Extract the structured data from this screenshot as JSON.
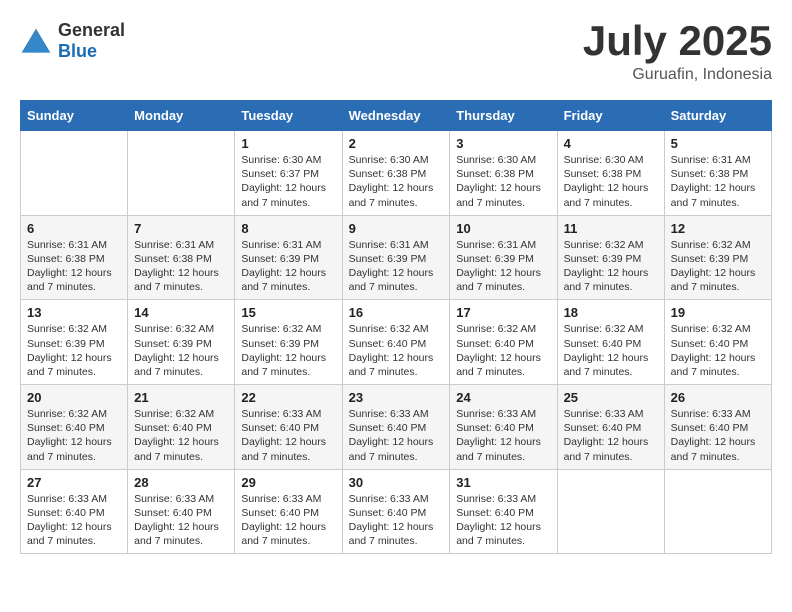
{
  "header": {
    "logo_general": "General",
    "logo_blue": "Blue",
    "month": "July 2025",
    "location": "Guruafin, Indonesia"
  },
  "days_of_week": [
    "Sunday",
    "Monday",
    "Tuesday",
    "Wednesday",
    "Thursday",
    "Friday",
    "Saturday"
  ],
  "weeks": [
    [
      {
        "day": "",
        "info": ""
      },
      {
        "day": "",
        "info": ""
      },
      {
        "day": "1",
        "info": "Sunrise: 6:30 AM\nSunset: 6:37 PM\nDaylight: 12 hours\nand 7 minutes."
      },
      {
        "day": "2",
        "info": "Sunrise: 6:30 AM\nSunset: 6:38 PM\nDaylight: 12 hours\nand 7 minutes."
      },
      {
        "day": "3",
        "info": "Sunrise: 6:30 AM\nSunset: 6:38 PM\nDaylight: 12 hours\nand 7 minutes."
      },
      {
        "day": "4",
        "info": "Sunrise: 6:30 AM\nSunset: 6:38 PM\nDaylight: 12 hours\nand 7 minutes."
      },
      {
        "day": "5",
        "info": "Sunrise: 6:31 AM\nSunset: 6:38 PM\nDaylight: 12 hours\nand 7 minutes."
      }
    ],
    [
      {
        "day": "6",
        "info": "Sunrise: 6:31 AM\nSunset: 6:38 PM\nDaylight: 12 hours\nand 7 minutes."
      },
      {
        "day": "7",
        "info": "Sunrise: 6:31 AM\nSunset: 6:38 PM\nDaylight: 12 hours\nand 7 minutes."
      },
      {
        "day": "8",
        "info": "Sunrise: 6:31 AM\nSunset: 6:39 PM\nDaylight: 12 hours\nand 7 minutes."
      },
      {
        "day": "9",
        "info": "Sunrise: 6:31 AM\nSunset: 6:39 PM\nDaylight: 12 hours\nand 7 minutes."
      },
      {
        "day": "10",
        "info": "Sunrise: 6:31 AM\nSunset: 6:39 PM\nDaylight: 12 hours\nand 7 minutes."
      },
      {
        "day": "11",
        "info": "Sunrise: 6:32 AM\nSunset: 6:39 PM\nDaylight: 12 hours\nand 7 minutes."
      },
      {
        "day": "12",
        "info": "Sunrise: 6:32 AM\nSunset: 6:39 PM\nDaylight: 12 hours\nand 7 minutes."
      }
    ],
    [
      {
        "day": "13",
        "info": "Sunrise: 6:32 AM\nSunset: 6:39 PM\nDaylight: 12 hours\nand 7 minutes."
      },
      {
        "day": "14",
        "info": "Sunrise: 6:32 AM\nSunset: 6:39 PM\nDaylight: 12 hours\nand 7 minutes."
      },
      {
        "day": "15",
        "info": "Sunrise: 6:32 AM\nSunset: 6:39 PM\nDaylight: 12 hours\nand 7 minutes."
      },
      {
        "day": "16",
        "info": "Sunrise: 6:32 AM\nSunset: 6:40 PM\nDaylight: 12 hours\nand 7 minutes."
      },
      {
        "day": "17",
        "info": "Sunrise: 6:32 AM\nSunset: 6:40 PM\nDaylight: 12 hours\nand 7 minutes."
      },
      {
        "day": "18",
        "info": "Sunrise: 6:32 AM\nSunset: 6:40 PM\nDaylight: 12 hours\nand 7 minutes."
      },
      {
        "day": "19",
        "info": "Sunrise: 6:32 AM\nSunset: 6:40 PM\nDaylight: 12 hours\nand 7 minutes."
      }
    ],
    [
      {
        "day": "20",
        "info": "Sunrise: 6:32 AM\nSunset: 6:40 PM\nDaylight: 12 hours\nand 7 minutes."
      },
      {
        "day": "21",
        "info": "Sunrise: 6:32 AM\nSunset: 6:40 PM\nDaylight: 12 hours\nand 7 minutes."
      },
      {
        "day": "22",
        "info": "Sunrise: 6:33 AM\nSunset: 6:40 PM\nDaylight: 12 hours\nand 7 minutes."
      },
      {
        "day": "23",
        "info": "Sunrise: 6:33 AM\nSunset: 6:40 PM\nDaylight: 12 hours\nand 7 minutes."
      },
      {
        "day": "24",
        "info": "Sunrise: 6:33 AM\nSunset: 6:40 PM\nDaylight: 12 hours\nand 7 minutes."
      },
      {
        "day": "25",
        "info": "Sunrise: 6:33 AM\nSunset: 6:40 PM\nDaylight: 12 hours\nand 7 minutes."
      },
      {
        "day": "26",
        "info": "Sunrise: 6:33 AM\nSunset: 6:40 PM\nDaylight: 12 hours\nand 7 minutes."
      }
    ],
    [
      {
        "day": "27",
        "info": "Sunrise: 6:33 AM\nSunset: 6:40 PM\nDaylight: 12 hours\nand 7 minutes."
      },
      {
        "day": "28",
        "info": "Sunrise: 6:33 AM\nSunset: 6:40 PM\nDaylight: 12 hours\nand 7 minutes."
      },
      {
        "day": "29",
        "info": "Sunrise: 6:33 AM\nSunset: 6:40 PM\nDaylight: 12 hours\nand 7 minutes."
      },
      {
        "day": "30",
        "info": "Sunrise: 6:33 AM\nSunset: 6:40 PM\nDaylight: 12 hours\nand 7 minutes."
      },
      {
        "day": "31",
        "info": "Sunrise: 6:33 AM\nSunset: 6:40 PM\nDaylight: 12 hours\nand 7 minutes."
      },
      {
        "day": "",
        "info": ""
      },
      {
        "day": "",
        "info": ""
      }
    ]
  ]
}
